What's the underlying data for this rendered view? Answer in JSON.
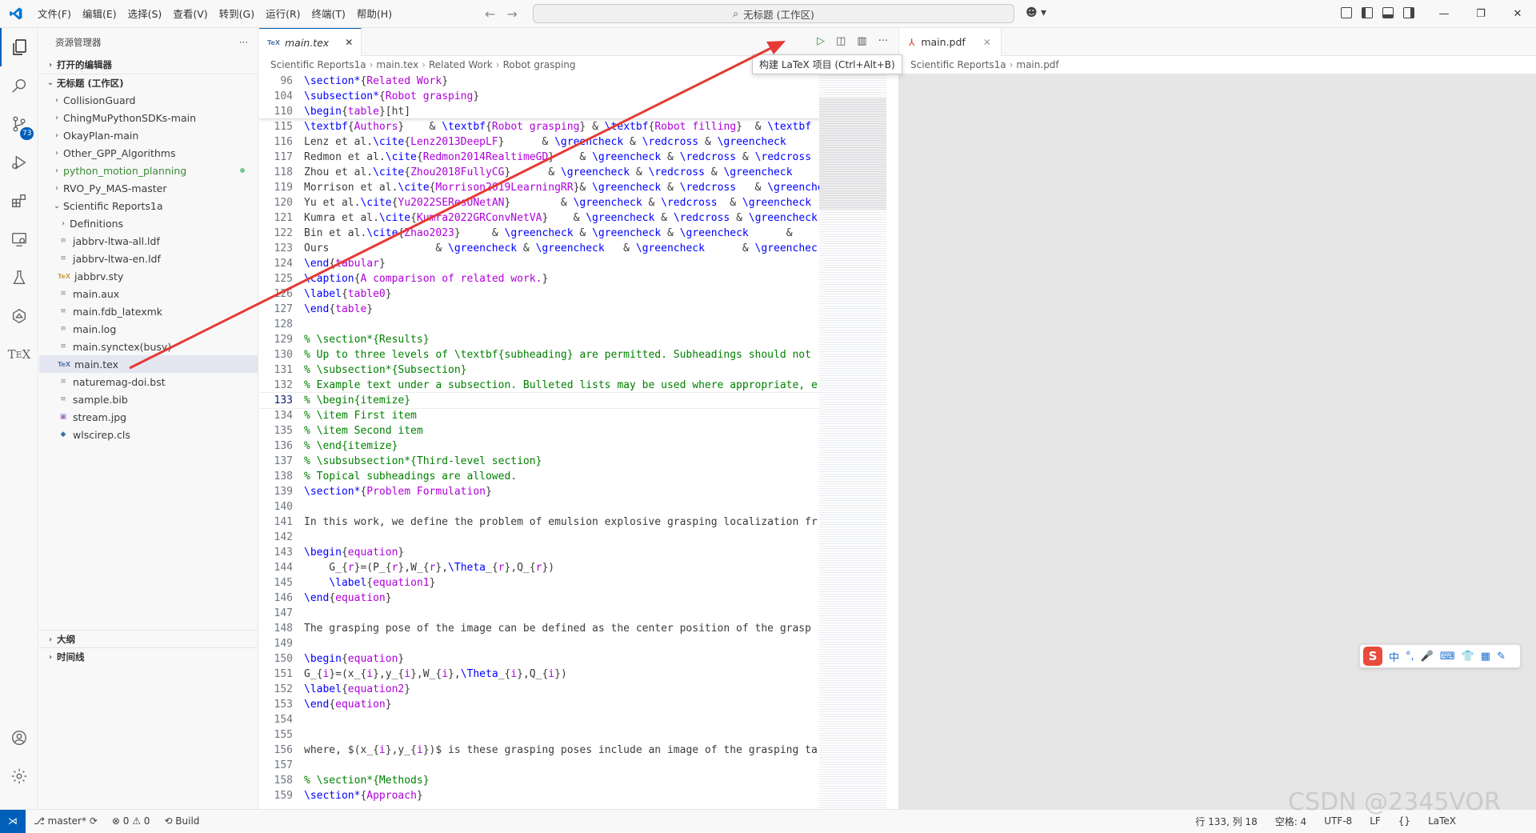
{
  "menu": [
    "文件(F)",
    "编辑(E)",
    "选择(S)",
    "查看(V)",
    "转到(G)",
    "运行(R)",
    "终端(T)",
    "帮助(H)"
  ],
  "command_center": "无标题 (工作区)",
  "sidebar": {
    "title": "资源管理器",
    "open_editors": "打开的编辑器",
    "workspace": "无标题 (工作区)",
    "folders": [
      {
        "label": "CollisionGuard",
        "color": "#3b3b3b"
      },
      {
        "label": "ChingMuPythonSDKs-main",
        "color": "#3b3b3b"
      },
      {
        "label": "OkayPlan-main",
        "color": "#3b3b3b"
      },
      {
        "label": "Other_GPP_Algorithms",
        "color": "#3b3b3b"
      },
      {
        "label": "python_motion_planning",
        "color": "#388a34"
      },
      {
        "label": "RVO_Py_MAS-master",
        "color": "#3b3b3b"
      }
    ],
    "open_folder": "Scientific Reports1a",
    "sub_folder": "Definitions",
    "files": [
      {
        "label": "jabbrv-ltwa-all.ldf",
        "icon": "file-icon"
      },
      {
        "label": "jabbrv-ltwa-en.ldf",
        "icon": "file-icon"
      },
      {
        "label": "jabbrv.sty",
        "icon": "tex-icon"
      },
      {
        "label": "main.aux",
        "icon": "file-icon"
      },
      {
        "label": "main.fdb_latexmk",
        "icon": "file-icon"
      },
      {
        "label": "main.log",
        "icon": "file-icon"
      },
      {
        "label": "main.synctex(busy)",
        "icon": "file-icon"
      },
      {
        "label": "main.tex",
        "icon": "tex-icon",
        "selected": true
      },
      {
        "label": "naturemag-doi.bst",
        "icon": "file-icon"
      },
      {
        "label": "sample.bib",
        "icon": "file-icon"
      },
      {
        "label": "stream.jpg",
        "icon": "image-icon"
      },
      {
        "label": "wlscirep.cls",
        "icon": "file-icon"
      }
    ],
    "outline": "大纲",
    "timeline": "时间线"
  },
  "activity_badge": "73",
  "editor": {
    "tab_label": "main.tex",
    "breadcrumb": [
      "Scientific Reports1a",
      "main.tex",
      "Related Work",
      "Robot grasping"
    ],
    "tooltip": "构建 LaTeX 项目 (Ctrl+Alt+B)",
    "sticky": [
      {
        "n": "96",
        "t": "\\section*{Related Work}"
      },
      {
        "n": "104",
        "t": "\\subsection*{Robot grasping}"
      },
      {
        "n": "110",
        "t": "\\begin{table}[ht]"
      }
    ],
    "lines": [
      {
        "n": "115",
        "t": "\\textbf{Authors}    & \\textbf{Robot grasping} & \\textbf{Robot filling}  & \\textbf"
      },
      {
        "n": "116",
        "t": "Lenz et al.\\cite{Lenz2013DeepLF}      & \\greencheck & \\redcross & \\greencheck"
      },
      {
        "n": "117",
        "t": "Redmon et al.\\cite{Redmon2014RealtimeGD}    & \\greencheck & \\redcross & \\redcross"
      },
      {
        "n": "118",
        "t": "Zhou et al.\\cite{Zhou2018FullyCG}      & \\greencheck & \\redcross & \\greencheck"
      },
      {
        "n": "119",
        "t": "Morrison et al.\\cite{Morrison2019LearningRR}& \\greencheck & \\redcross   & \\greenche"
      },
      {
        "n": "120",
        "t": "Yu et al.\\cite{Yu2022SEResUNetAN}        & \\greencheck & \\redcross  & \\greencheck"
      },
      {
        "n": "121",
        "t": "Kumra et al.\\cite{Kumra2022GRConvNetVA}    & \\greencheck & \\redcross & \\greencheck"
      },
      {
        "n": "122",
        "t": "Bin et al.\\cite{Zhao2023}     & \\greencheck & \\greencheck & \\greencheck      &"
      },
      {
        "n": "123",
        "t": "Ours                 & \\greencheck & \\greencheck   & \\greencheck      & \\greenchec"
      },
      {
        "n": "124",
        "t": "\\end{tabular}"
      },
      {
        "n": "125",
        "t": "\\caption{A comparison of related work.}"
      },
      {
        "n": "126",
        "t": "\\label{table0}"
      },
      {
        "n": "127",
        "t": "\\end{table}"
      },
      {
        "n": "128",
        "t": ""
      },
      {
        "n": "129",
        "t": "% \\section*{Results}"
      },
      {
        "n": "130",
        "t": "% Up to three levels of \\textbf{subheading} are permitted. Subheadings should not"
      },
      {
        "n": "131",
        "t": "% \\subsection*{Subsection}"
      },
      {
        "n": "132",
        "t": "% Example text under a subsection. Bulleted lists may be used where appropriate, e"
      },
      {
        "n": "133",
        "t": "% \\begin{itemize}",
        "current": true
      },
      {
        "n": "134",
        "t": "% \\item First item"
      },
      {
        "n": "135",
        "t": "% \\item Second item"
      },
      {
        "n": "136",
        "t": "% \\end{itemize}"
      },
      {
        "n": "137",
        "t": "% \\subsubsection*{Third-level section}"
      },
      {
        "n": "138",
        "t": "% Topical subheadings are allowed."
      },
      {
        "n": "139",
        "t": "\\section*{Problem Formulation}"
      },
      {
        "n": "140",
        "t": ""
      },
      {
        "n": "141",
        "t": "In this work, we define the problem of emulsion explosive grasping localization fr"
      },
      {
        "n": "142",
        "t": ""
      },
      {
        "n": "143",
        "t": "\\begin{equation}"
      },
      {
        "n": "144",
        "t": "    G_{r}=(P_{r},W_{r},\\Theta_{r},Q_{r})"
      },
      {
        "n": "145",
        "t": "    \\label{equation1}"
      },
      {
        "n": "146",
        "t": "\\end{equation}"
      },
      {
        "n": "147",
        "t": ""
      },
      {
        "n": "148",
        "t": "The grasping pose of the image can be defined as the center position of the grasp"
      },
      {
        "n": "149",
        "t": ""
      },
      {
        "n": "150",
        "t": "\\begin{equation}"
      },
      {
        "n": "151",
        "t": "G_{i}=(x_{i},y_{i},W_{i},\\Theta_{i},Q_{i})"
      },
      {
        "n": "152",
        "t": "\\label{equation2}"
      },
      {
        "n": "153",
        "t": "\\end{equation}"
      },
      {
        "n": "154",
        "t": ""
      },
      {
        "n": "155",
        "t": ""
      },
      {
        "n": "156",
        "t": "where, $(x_{i},y_{i})$ is these grasping poses include an image of the grasping ta"
      },
      {
        "n": "157",
        "t": ""
      },
      {
        "n": "158",
        "t": "% \\section*{Methods}"
      },
      {
        "n": "159",
        "t": "\\section*{Approach}"
      }
    ]
  },
  "pdf": {
    "tab_label": "main.pdf",
    "breadcrumb": [
      "Scientific Reports1a",
      "main.pdf"
    ]
  },
  "statusbar": {
    "branch": "master*",
    "problems": "⊗ 0 ⚠ 0",
    "build": "Build",
    "cursor": "行 133, 列 18",
    "indent": "空格: 4",
    "encoding": "UTF-8",
    "eol": "LF",
    "braces": "{}",
    "language": "LaTeX"
  },
  "watermark": "CSDN @2345VOR",
  "ime": [
    "中",
    "°,",
    "🎤",
    "⌨",
    "👕",
    "▦",
    "✎"
  ],
  "colors": {
    "accent": "#005fb8",
    "keyword_purple": "#af00db",
    "command_blue": "#0000ff",
    "comment_green": "#008000",
    "arrow_red": "#e53935"
  }
}
